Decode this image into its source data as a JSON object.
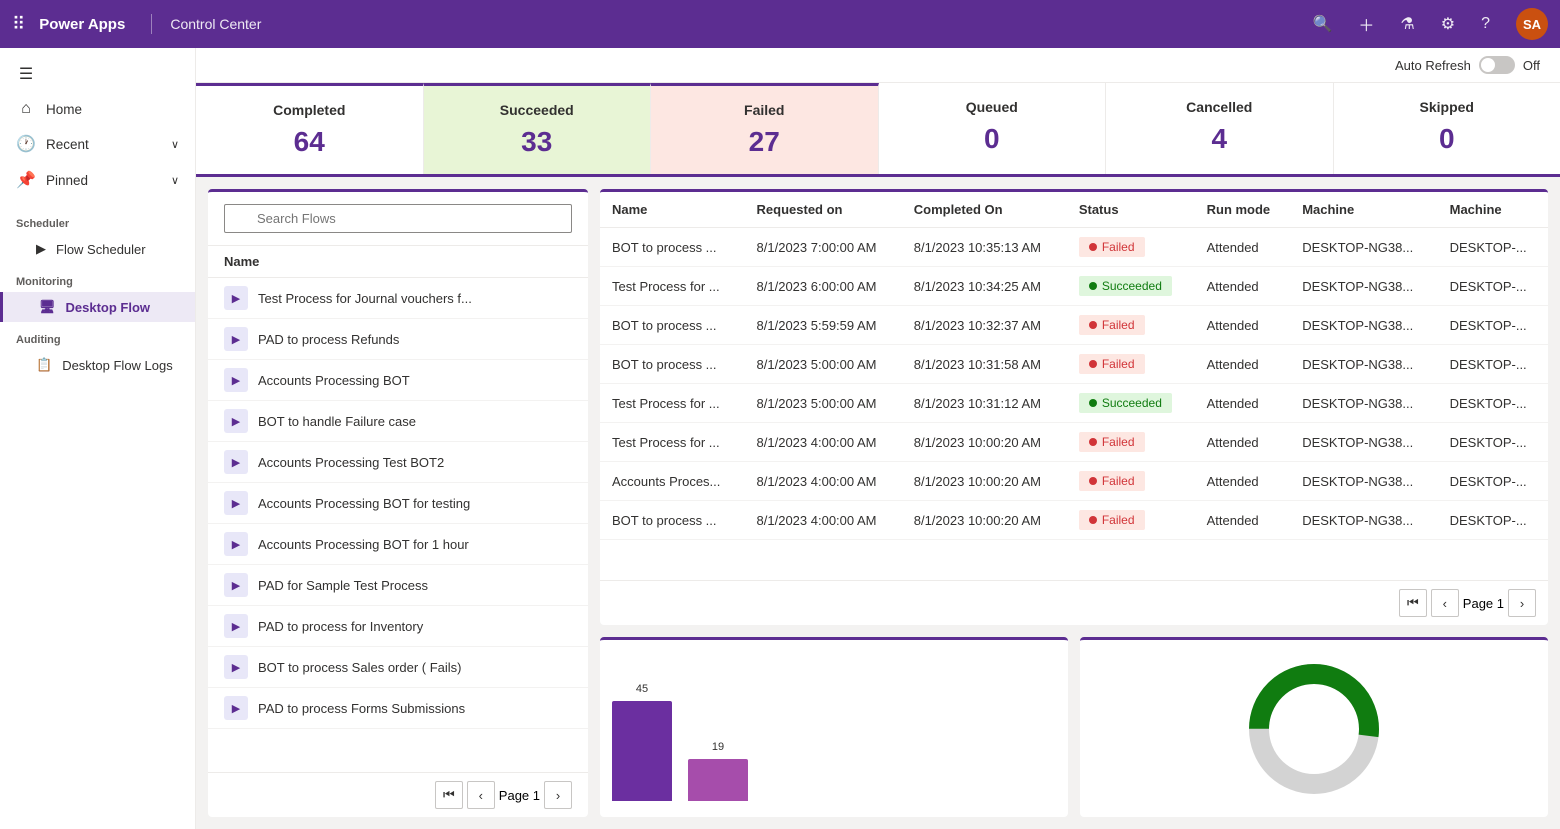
{
  "topNav": {
    "appName": "Power Apps",
    "pageTitle": "Control Center",
    "avatarLabel": "SA"
  },
  "autoRefresh": {
    "label": "Auto Refresh",
    "state": "Off"
  },
  "stats": [
    {
      "label": "Completed",
      "value": "64",
      "type": "completed"
    },
    {
      "label": "Succeeded",
      "value": "33",
      "type": "succeeded"
    },
    {
      "label": "Failed",
      "value": "27",
      "type": "failed"
    },
    {
      "label": "Queued",
      "value": "0",
      "type": "queued"
    },
    {
      "label": "Cancelled",
      "value": "4",
      "type": "cancelled"
    },
    {
      "label": "Skipped",
      "value": "0",
      "type": "skipped"
    }
  ],
  "sidebar": {
    "hamburger": "☰",
    "items": [
      {
        "id": "home",
        "label": "Home",
        "icon": "⌂"
      },
      {
        "id": "recent",
        "label": "Recent",
        "icon": "🕐",
        "hasChevron": true
      },
      {
        "id": "pinned",
        "label": "Pinned",
        "icon": "📌",
        "hasChevron": true
      }
    ],
    "sections": [
      {
        "label": "Scheduler",
        "items": [
          {
            "id": "flow-scheduler",
            "label": "Flow Scheduler",
            "icon": "⟳",
            "isSubItem": true
          }
        ]
      },
      {
        "label": "Monitoring",
        "items": [
          {
            "id": "desktop-flow",
            "label": "Desktop Flow",
            "icon": "🖥",
            "isSubItem": true,
            "active": true
          }
        ]
      },
      {
        "label": "Auditing",
        "items": [
          {
            "id": "desktop-flow-logs",
            "label": "Desktop Flow Logs",
            "icon": "📋",
            "isSubItem": true
          }
        ]
      }
    ]
  },
  "flowList": {
    "searchPlaceholder": "Search Flows",
    "nameHeader": "Name",
    "items": [
      "Test Process for Journal vouchers f...",
      "PAD to process Refunds",
      "Accounts Processing BOT",
      "BOT to handle Failure case",
      "Accounts Processing Test BOT2",
      "Accounts Processing BOT for testing",
      "Accounts Processing BOT for 1 hour",
      "PAD for Sample Test Process",
      "PAD to process for Inventory",
      "BOT to process Sales order ( Fails)",
      "PAD to process Forms Submissions"
    ],
    "pagination": {
      "pageLabel": "Page 1"
    }
  },
  "table": {
    "columns": [
      "Name",
      "Requested on",
      "Completed On",
      "Status",
      "Run mode",
      "Machine",
      "Machine"
    ],
    "rows": [
      {
        "name": "BOT to process ...",
        "requestedOn": "8/1/2023 7:00:00 AM",
        "completedOn": "8/1/2023 10:35:13 AM",
        "status": "Failed",
        "runMode": "Attended",
        "machine": "DESKTOP-NG38...",
        "machine2": "DESKTOP-..."
      },
      {
        "name": "Test Process for ...",
        "requestedOn": "8/1/2023 6:00:00 AM",
        "completedOn": "8/1/2023 10:34:25 AM",
        "status": "Succeeded",
        "runMode": "Attended",
        "machine": "DESKTOP-NG38...",
        "machine2": "DESKTOP-..."
      },
      {
        "name": "BOT to process ...",
        "requestedOn": "8/1/2023 5:59:59 AM",
        "completedOn": "8/1/2023 10:32:37 AM",
        "status": "Failed",
        "runMode": "Attended",
        "machine": "DESKTOP-NG38...",
        "machine2": "DESKTOP-..."
      },
      {
        "name": "BOT to process ...",
        "requestedOn": "8/1/2023 5:00:00 AM",
        "completedOn": "8/1/2023 10:31:58 AM",
        "status": "Failed",
        "runMode": "Attended",
        "machine": "DESKTOP-NG38...",
        "machine2": "DESKTOP-..."
      },
      {
        "name": "Test Process for ...",
        "requestedOn": "8/1/2023 5:00:00 AM",
        "completedOn": "8/1/2023 10:31:12 AM",
        "status": "Succeeded",
        "runMode": "Attended",
        "machine": "DESKTOP-NG38...",
        "machine2": "DESKTOP-..."
      },
      {
        "name": "Test Process for ...",
        "requestedOn": "8/1/2023 4:00:00 AM",
        "completedOn": "8/1/2023 10:00:20 AM",
        "status": "Failed",
        "runMode": "Attended",
        "machine": "DESKTOP-NG38...",
        "machine2": "DESKTOP-..."
      },
      {
        "name": "Accounts Proces...",
        "requestedOn": "8/1/2023 4:00:00 AM",
        "completedOn": "8/1/2023 10:00:20 AM",
        "status": "Failed",
        "runMode": "Attended",
        "machine": "DESKTOP-NG38...",
        "machine2": "DESKTOP-..."
      },
      {
        "name": "BOT to process ...",
        "requestedOn": "8/1/2023 4:00:00 AM",
        "completedOn": "8/1/2023 10:00:20 AM",
        "status": "Failed",
        "runMode": "Attended",
        "machine": "DESKTOP-NG38...",
        "machine2": "DESKTOP-..."
      }
    ],
    "pagination": {
      "pageLabel": "Page 1"
    }
  },
  "barChart": {
    "bars": [
      {
        "value": 45,
        "color": "#6b2fa0",
        "label": ""
      },
      {
        "value": 19,
        "color": "#a64dab",
        "label": ""
      }
    ]
  },
  "donutChart": {
    "segments": [
      {
        "color": "#107c10",
        "percent": 52
      },
      {
        "color": "#d3d3d3",
        "percent": 48
      }
    ]
  }
}
